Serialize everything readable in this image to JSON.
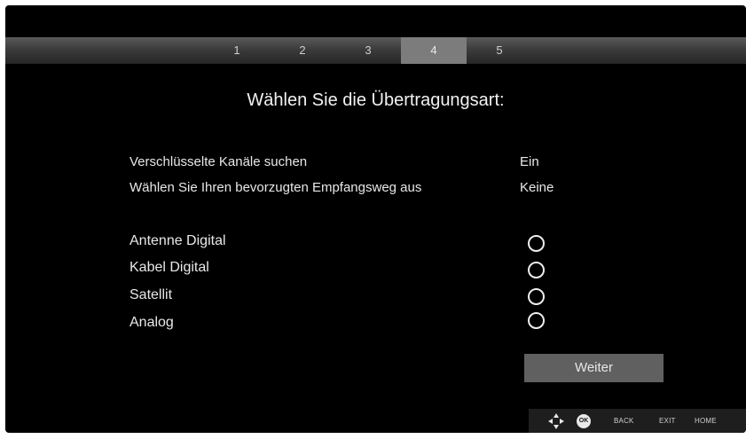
{
  "steps": [
    {
      "label": "1",
      "active": false
    },
    {
      "label": "2",
      "active": false
    },
    {
      "label": "3",
      "active": false
    },
    {
      "label": "4",
      "active": true
    },
    {
      "label": "5",
      "active": false
    }
  ],
  "title": "Wählen Sie die Übertragungsart:",
  "settings": [
    {
      "label": "Verschlüsselte Kanäle suchen",
      "value": "Ein"
    },
    {
      "label": "Wählen Sie Ihren bevorzugten Empfangsweg aus",
      "value": "Keine"
    }
  ],
  "options": [
    {
      "label": "Antenne Digital",
      "selected": false
    },
    {
      "label": "Kabel Digital",
      "selected": false
    },
    {
      "label": "Satellit",
      "selected": false
    },
    {
      "label": "Analog",
      "selected": false
    }
  ],
  "next_button": "Weiter",
  "help": {
    "nav_icon": "dpad-icon",
    "ok_label": "OK",
    "back_label": "BACK",
    "exit_label": "EXIT",
    "home_label": "HOME"
  },
  "colors": {
    "background": "#000000",
    "active_step": "#7c7c7c",
    "button": "#606060"
  }
}
